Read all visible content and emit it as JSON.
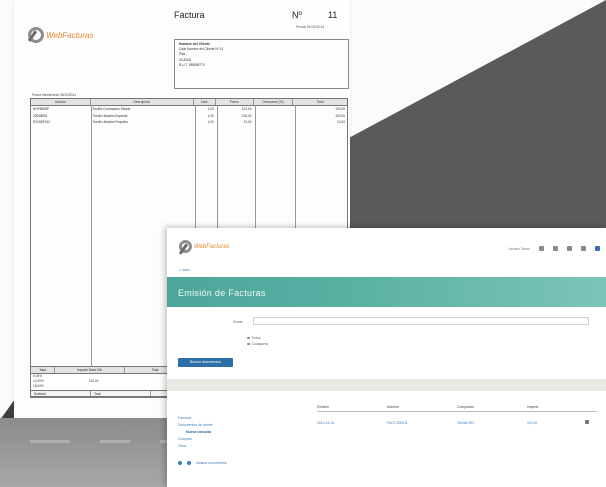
{
  "brand": {
    "logo_text": "WebFacturas",
    "accent": "#e08a2f"
  },
  "invoice": {
    "title": "Factura",
    "number_label": "Nº",
    "number": "11",
    "date": "Fecha  01/01/2014",
    "client": {
      "name": "Nombre del Cliente",
      "lines": [
        "Calle Nombre del Cliente Nº 11",
        "Pais",
        "CIUDAD",
        "R.U.T.   998855770"
      ]
    },
    "issue_date": "Fecha Vencimiento  30/10/2014",
    "columns": [
      "Artículo",
      "Descripción",
      "Cant.",
      "Precio",
      "Descuento (%)",
      "Total"
    ],
    "rows": [
      [
        "NHP5848P",
        "Rodillo Contrapeso Simple",
        "1,00",
        "101,00",
        "",
        "100,00"
      ],
      [
        "2000B891",
        "Tornillo Madera Especial",
        "1,00",
        "100,00",
        "",
        "100,00"
      ],
      [
        "R200BF012",
        "Tornillo Madera Pequeño",
        "1,00",
        "10,00",
        "",
        "10,00"
      ]
    ],
    "totals_columns": [
      "Tasa",
      "Importe Base IVA",
      "Total"
    ],
    "totals_rows": [
      "0,00%",
      "12,00%",
      "18,00%"
    ],
    "totals_middle": "110,00",
    "footer": [
      "Subtotal",
      "Total",
      ""
    ]
  },
  "app": {
    "user": "Usuario Demo",
    "breadcrumb": "< Inicio",
    "page_title": "Emisión de Facturas",
    "filter_label": "Desde",
    "radio_options": [
      "Todos",
      "Cualquiera"
    ],
    "search_button": "Buscar documentos",
    "list_columns": [
      "Emisión",
      "Número",
      "Comprador",
      "Importe"
    ],
    "list_row": [
      "2014-01-01",
      "FACT-000011",
      "Cliente 001",
      "110,00"
    ],
    "menu": [
      "Facturas",
      "Documentos de cliente",
      "Nueva consulta",
      "Compras",
      "Otros"
    ],
    "pager_label": "Mostrar documentos"
  }
}
